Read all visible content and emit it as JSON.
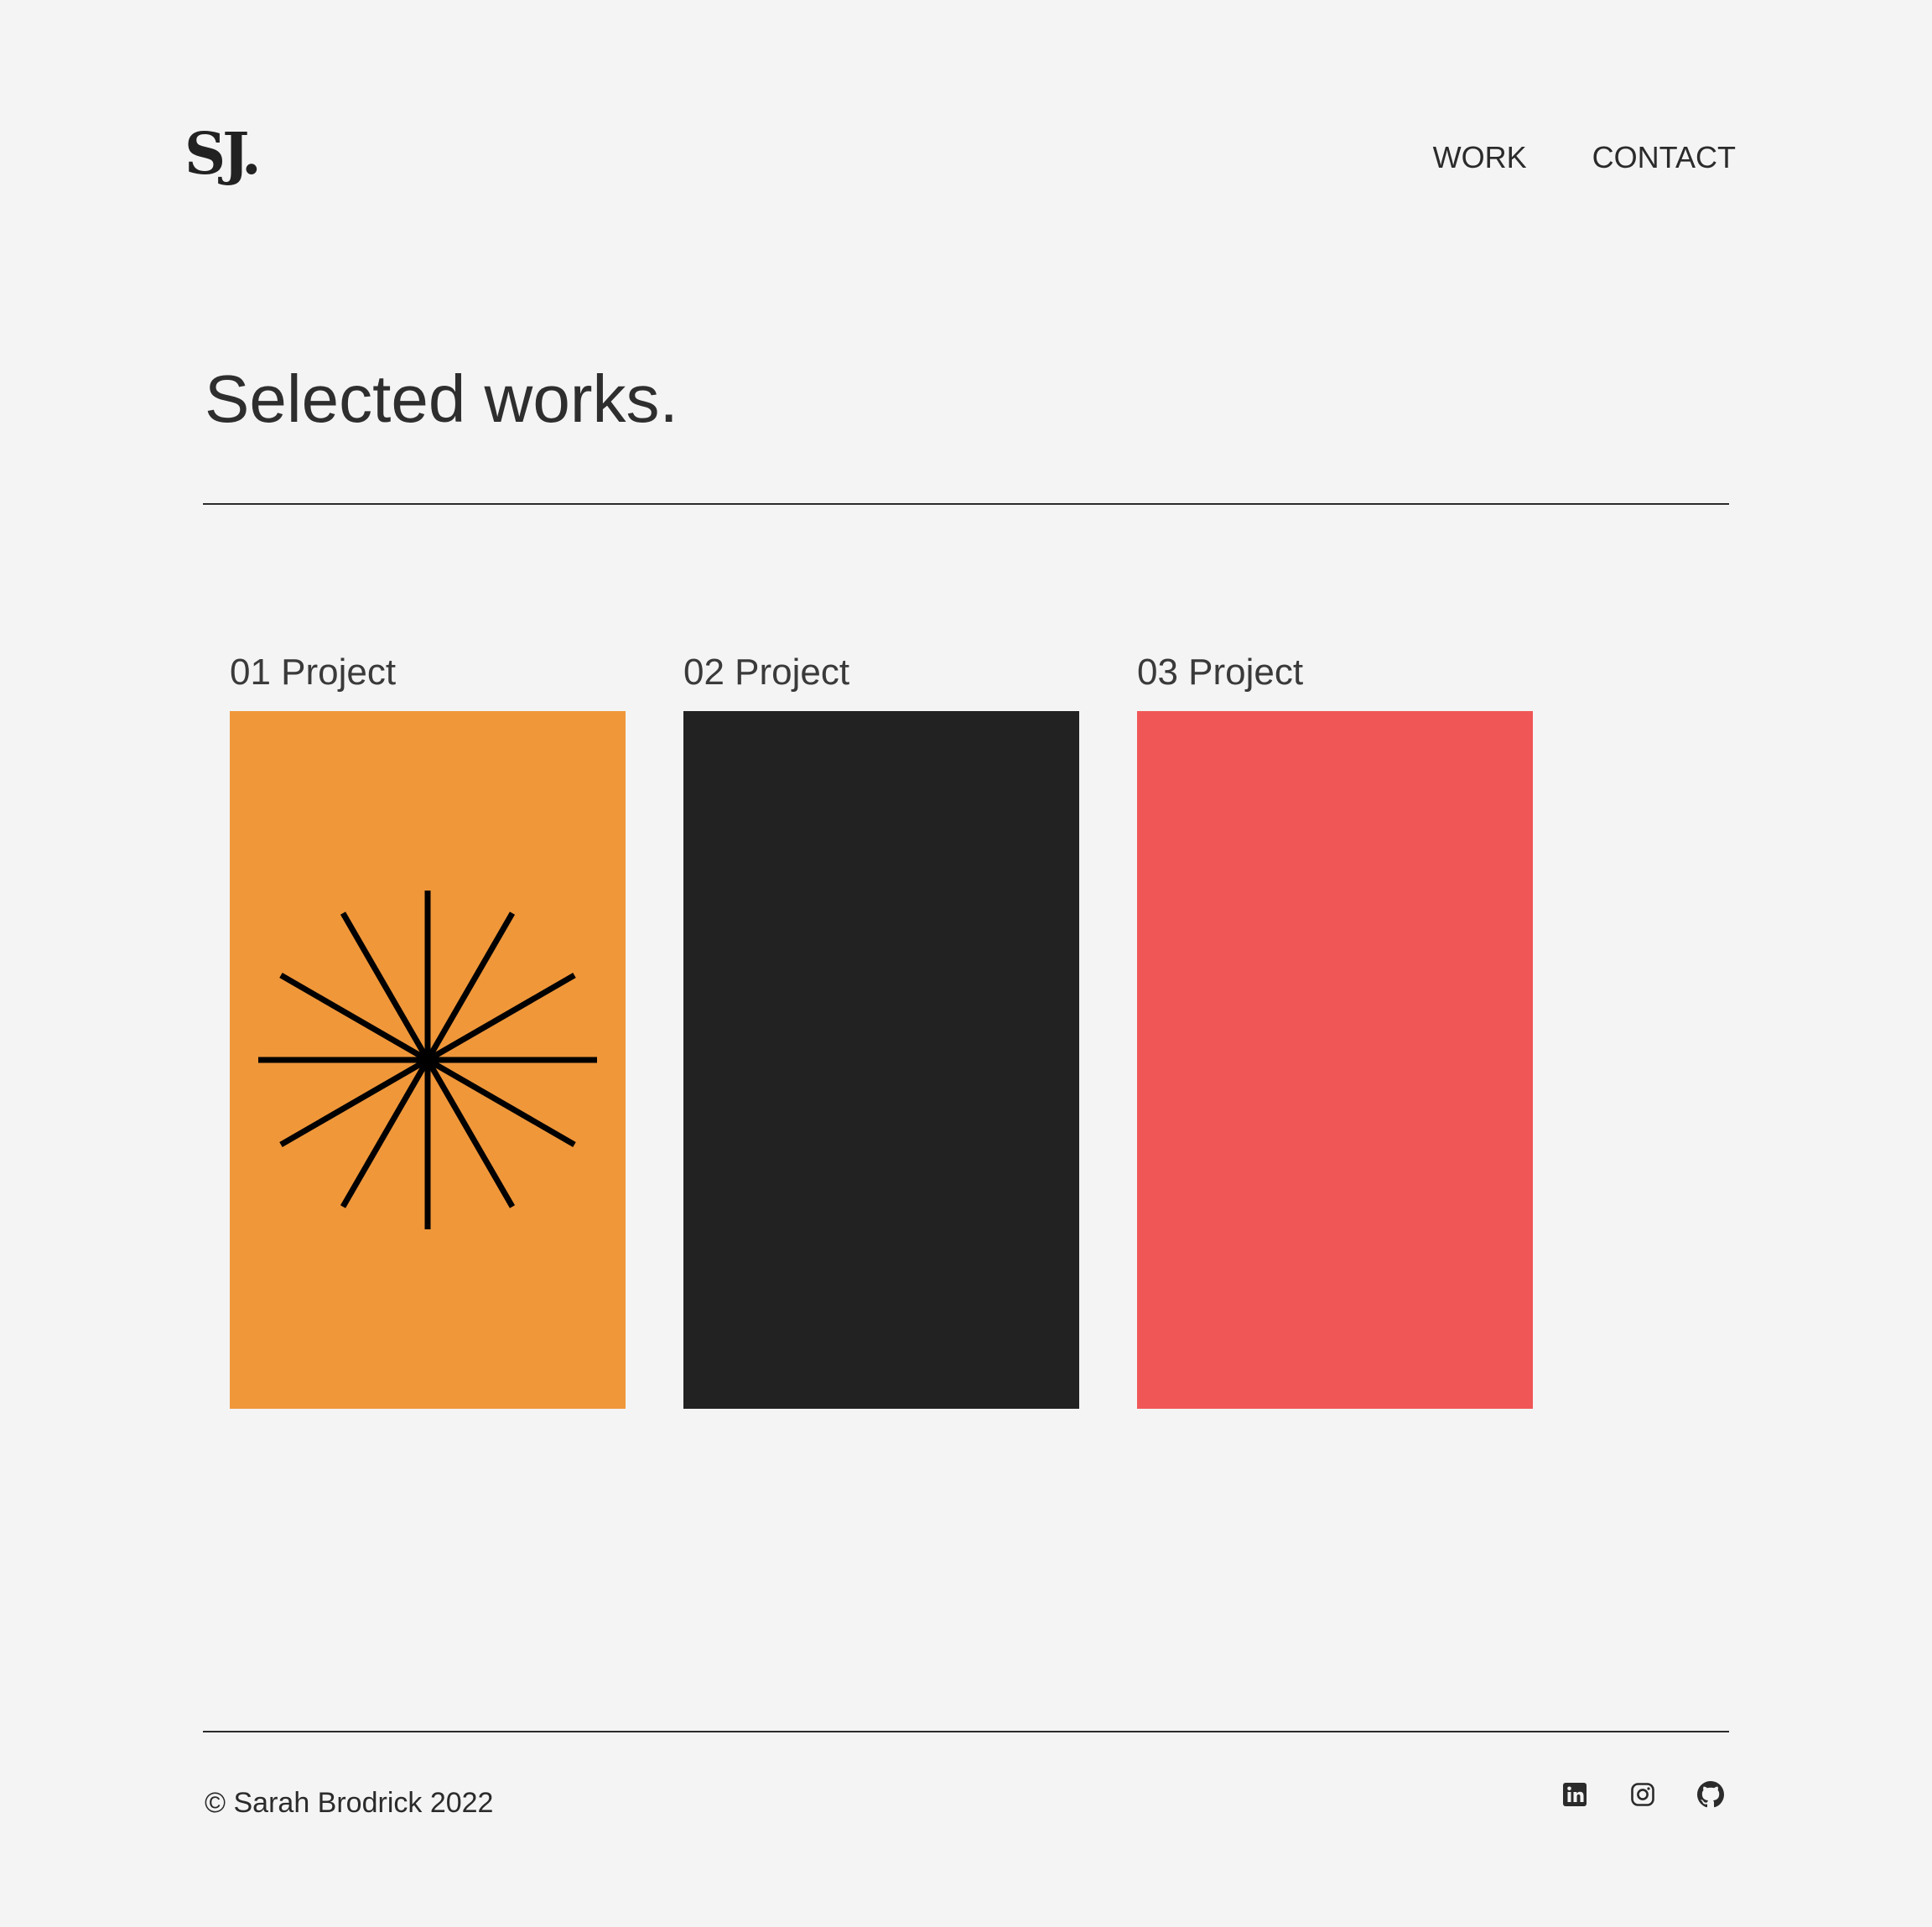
{
  "header": {
    "logo": "SJ.",
    "nav": [
      "WORK",
      "CONTACT"
    ]
  },
  "main": {
    "title": "Selected works.",
    "projects": [
      {
        "label": "01 Project",
        "color": "#f0973a"
      },
      {
        "label": "02 Project",
        "color": "#222222"
      },
      {
        "label": "03 Project",
        "color": "#f15656"
      }
    ]
  },
  "footer": {
    "copyright": "© Sarah Brodrick 2022",
    "socials": [
      "linkedin-icon",
      "instagram-icon",
      "github-icon"
    ]
  }
}
